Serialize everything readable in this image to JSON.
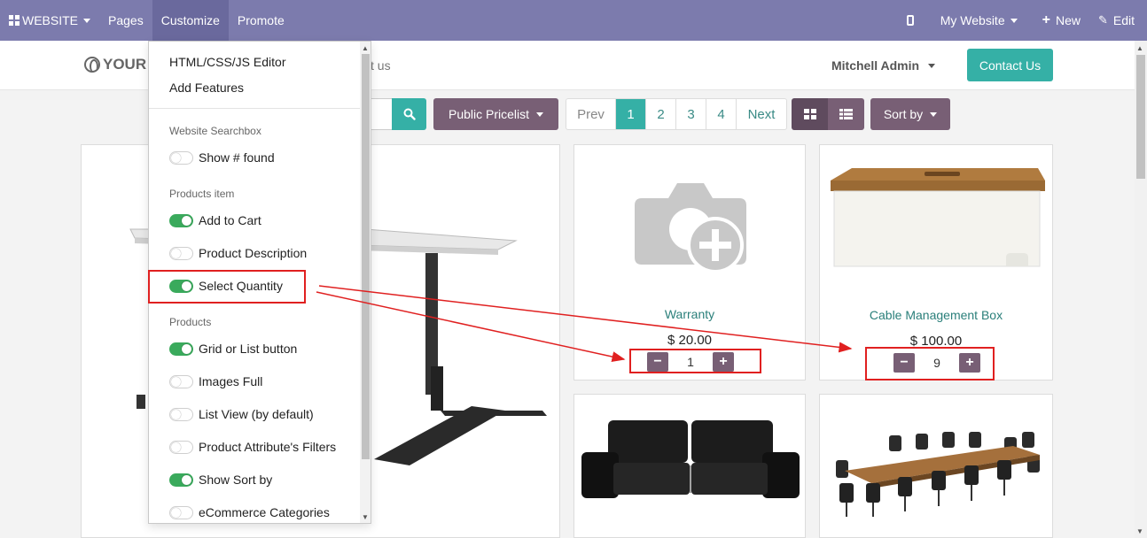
{
  "topbar": {
    "website_label": "WEBSITE",
    "pages_label": "Pages",
    "customize_label": "Customize",
    "promote_label": "Promote",
    "my_website_label": "My Website",
    "new_label": "New",
    "edit_label": "Edit",
    "bar_color": "#7c7bad"
  },
  "site_header": {
    "logo_text": "YOUR",
    "nav_link_fragment": "ct us",
    "user_name": "Mitchell Admin",
    "contact_button": "Contact Us"
  },
  "toolbar": {
    "pricelist_label": "Public Pricelist",
    "pager": {
      "prev": "Prev",
      "pages": [
        "1",
        "2",
        "3",
        "4"
      ],
      "current": "1",
      "next": "Next"
    },
    "sort_label": "Sort by"
  },
  "customize_menu": {
    "links": [
      "HTML/CSS/JS Editor",
      "Add Features"
    ],
    "sections": [
      {
        "heading": "Website Searchbox",
        "options": [
          {
            "label": "Show # found",
            "enabled": false
          }
        ]
      },
      {
        "heading": "Products item",
        "options": [
          {
            "label": "Add to Cart",
            "enabled": true
          },
          {
            "label": "Product Description",
            "enabled": false
          },
          {
            "label": "Select Quantity",
            "enabled": true
          }
        ]
      },
      {
        "heading": "Products",
        "options": [
          {
            "label": "Grid or List button",
            "enabled": true
          },
          {
            "label": "Images Full",
            "enabled": false
          },
          {
            "label": "List View (by default)",
            "enabled": false
          },
          {
            "label": "Product Attribute's Filters",
            "enabled": false
          },
          {
            "label": "Show Sort by",
            "enabled": true
          },
          {
            "label": "eCommerce Categories",
            "enabled": false
          }
        ]
      }
    ]
  },
  "products": [
    {
      "name": "Warranty",
      "price": "$ 20.00",
      "quantity": "1",
      "image_icon": "camera-plus-placeholder-icon"
    },
    {
      "name": "Cable Management Box",
      "price": "$ 100.00",
      "quantity": "9",
      "image_icon": "cable-box-image"
    },
    {
      "name": "",
      "image_icon": "black-sofa-image"
    },
    {
      "name": "",
      "image_icon": "conference-table-image"
    },
    {
      "name": "",
      "image_icon": "standing-desk-image"
    }
  ],
  "accent_colors": {
    "teal": "#35b0a6",
    "mauve": "#785f75",
    "toggle_on": "#3aaa5c",
    "annotation_red": "#e02020"
  }
}
